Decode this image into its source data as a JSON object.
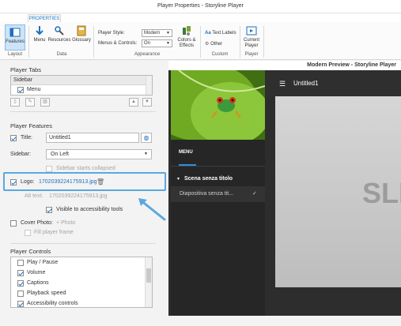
{
  "window": {
    "title": "Player Properties - Storyline Player"
  },
  "ribbon": {
    "tab": "PROPERTIES",
    "groups": {
      "layout": {
        "label": "Layout",
        "features": "Features"
      },
      "data": {
        "label": "Data",
        "menu": "Menu",
        "resources": "Resources",
        "glossary": "Glossary"
      },
      "appearance": {
        "label": "Appearance",
        "player_style_label": "Player Style:",
        "player_style_value": "Modern",
        "menus_controls_label": "Menus & Controls:",
        "menus_controls_value": "On",
        "colors_effects": "Colors & Effects"
      },
      "custom": {
        "label": "Custom",
        "text_labels": "Text Labels",
        "other": "Other"
      },
      "player": {
        "label": "Player",
        "current_player": "Current Player"
      }
    }
  },
  "left": {
    "player_tabs": {
      "heading": "Player Tabs",
      "list_header": "Sidebar",
      "items": [
        {
          "label": "Menu",
          "checked": true
        }
      ]
    },
    "player_features": {
      "heading": "Player Features",
      "title_label": "Title:",
      "title_value": "Untitled1",
      "sidebar_label": "Sidebar:",
      "sidebar_value": "On Left",
      "sidebar_collapsed": "Sidebar starts collapsed",
      "logo_label": "Logo:",
      "logo_file": "1702039224175913.jpg",
      "alt_text_label": "Alt text:",
      "alt_text_value": "1702039224175913.jpg",
      "visible_accessibility": "Visible to accessibility tools",
      "cover_photo_label": "Cover Photo:",
      "cover_photo_add": "+ Photo",
      "fill_player_frame": "Fill player frame"
    },
    "player_controls": {
      "heading": "Player Controls",
      "items": [
        {
          "label": "Play / Pause",
          "checked": false
        },
        {
          "label": "Volume",
          "checked": true
        },
        {
          "label": "Captions",
          "checked": true
        },
        {
          "label": "Playback speed",
          "checked": false
        },
        {
          "label": "Accessibility controls",
          "checked": true
        }
      ]
    }
  },
  "preview": {
    "title": "Modern Preview - Storyline Player",
    "course_title": "Untitled1",
    "menu_label": "MENU",
    "scene": "Scena senza titolo",
    "slide_item": "Diapositiva senza tit...",
    "slide_text": "SLI"
  }
}
